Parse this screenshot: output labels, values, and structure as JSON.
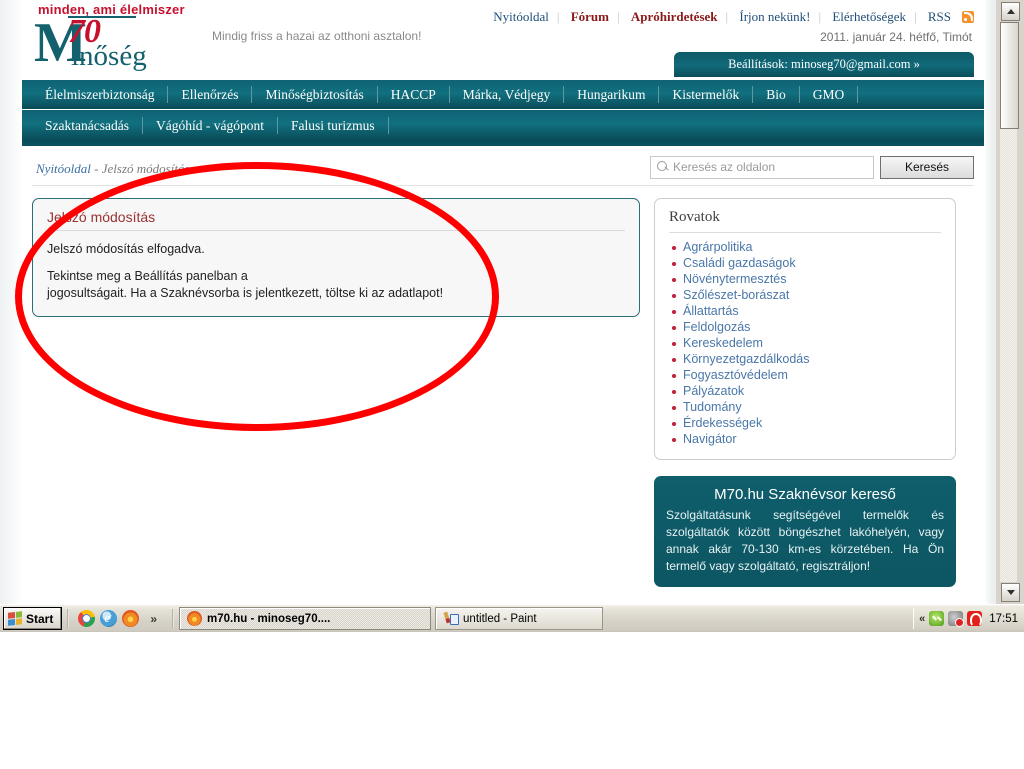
{
  "site": {
    "logo": {
      "tagline": "minden, ami élelmiszer",
      "m": "M",
      "seventy": "70",
      "inoseg": "inőség"
    },
    "slogan": "Mindig friss a hazai az otthoni asztalon!",
    "date": "2011. január 24. hétfő, Timót",
    "settings_button": "Beállítások: minoseg70@gmail.com »",
    "top_links": [
      {
        "label": "Nyitóoldal",
        "highlight": false
      },
      {
        "label": "Fórum",
        "highlight": true
      },
      {
        "label": "Apróhirdetések",
        "highlight": true
      },
      {
        "label": "Írjon nekünk!",
        "highlight": false
      },
      {
        "label": "Elérhetőségek",
        "highlight": false
      },
      {
        "label": "RSS",
        "highlight": false
      }
    ],
    "nav_row1": [
      "Élelmiszerbiztonság",
      "Ellenőrzés",
      "Minőségbiztosítás",
      "HACCP",
      "Márka, Védjegy",
      "Hungarikum",
      "Kistermelők",
      "Bio",
      "GMO"
    ],
    "nav_row2": [
      "Szaktanácsadás",
      "Vágóhíd - vágópont",
      "Falusi turizmus"
    ]
  },
  "breadcrumb": {
    "root": "Nyitóoldal",
    "separator": " - ",
    "current": "Jelszó módosítás"
  },
  "search": {
    "placeholder": "Keresés az oldalon",
    "value": "",
    "button": "Keresés"
  },
  "main_panel": {
    "title": "Jelszó módosítás",
    "line1": "Jelszó módosítás elfogadva.",
    "line2": "Tekintse meg a Beállítás panelban a",
    "line3": "jogosultságait. Ha a Szaknévsorba is jelentkezett, töltse ki az adatlapot!"
  },
  "sidebar": {
    "title": "Rovatok",
    "items": [
      "Agrárpolitika",
      "Családi gazdaságok",
      "Növénytermesztés",
      "Szőlészet-borászat",
      "Állattartás",
      "Feldolgozás",
      "Kereskedelem",
      "Környezetgazdálkodás",
      "Fogyasztóvédelem",
      "Pályázatok",
      "Tudomány",
      "Érdekességek",
      "Navigátor"
    ]
  },
  "promo": {
    "title": "M70.hu Szaknévsor kereső",
    "body": "Szolgáltatásunk segítségével termelők és szolgáltatók között böngészhet lakóhelyén, vagy annak akár 70-130 km-es körzetében. Ha Ön termelő vagy szolgáltató, regisztráljon!"
  },
  "taskbar": {
    "start": "Start",
    "overflow": "»",
    "windows": [
      {
        "label": "m70.hu - minoseg70....",
        "icon": "firefox-icon",
        "active": true
      },
      {
        "label": "untitled - Paint",
        "icon": "paint-icon",
        "active": false
      }
    ],
    "tray": {
      "expand": "«",
      "clock": "17:51"
    }
  },
  "colors": {
    "brand_teal": "#0f6273",
    "brand_red": "#c8102e",
    "annotation_red": "#fe0000",
    "link_blue": "#4a77a8",
    "heading_red": "#9a3232"
  }
}
